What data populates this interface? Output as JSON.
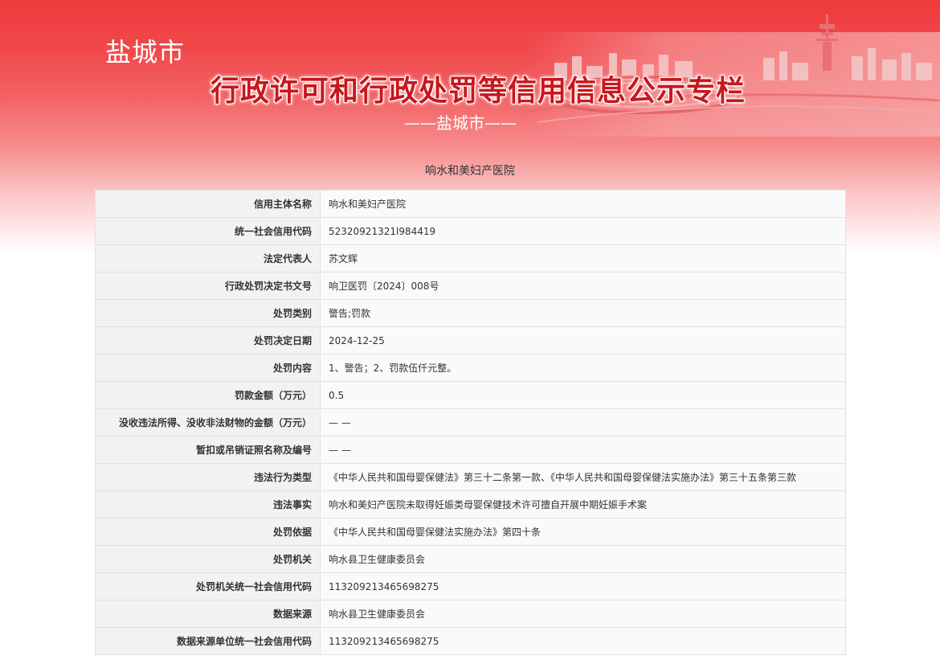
{
  "header": {
    "city": "盐城市",
    "title": "行政许可和行政处罚等信用信息公示专栏",
    "subtitle": "——盐城市——"
  },
  "entity_name": "响水和美妇产医院",
  "rows": [
    {
      "label": "信用主体名称",
      "value": "响水和美妇产医院"
    },
    {
      "label": "统一社会信用代码",
      "value": "52320921321l984419"
    },
    {
      "label": "法定代表人",
      "value": "苏文辉"
    },
    {
      "label": "行政处罚决定书文号",
      "value": "响卫医罚〔2024〕008号"
    },
    {
      "label": "处罚类别",
      "value": "警告;罚款"
    },
    {
      "label": "处罚决定日期",
      "value": "2024-12-25"
    },
    {
      "label": "处罚内容",
      "value": "1、警告；2、罚款伍仟元整。"
    },
    {
      "label": "罚款金额（万元）",
      "value": "0.5"
    },
    {
      "label": "没收违法所得、没收非法财物的金额（万元）",
      "value": "— —"
    },
    {
      "label": "暂扣或吊销证照名称及编号",
      "value": "— —"
    },
    {
      "label": "违法行为类型",
      "value": "《中华人民共和国母婴保健法》第三十二条第一款、《中华人民共和国母婴保健法实施办法》第三十五条第三款"
    },
    {
      "label": "违法事实",
      "value": "响水和美妇产医院未取得妊娠类母婴保健技术许可擅自开展中期妊娠手术案"
    },
    {
      "label": "处罚依据",
      "value": "《中华人民共和国母婴保健法实施办法》第四十条"
    },
    {
      "label": "处罚机关",
      "value": "响水县卫生健康委员会"
    },
    {
      "label": "处罚机关统一社会信用代码",
      "value": "113209213465698275"
    },
    {
      "label": "数据来源",
      "value": "响水县卫生健康委员会"
    },
    {
      "label": "数据来源单位统一社会信用代码",
      "value": "113209213465698275"
    }
  ]
}
